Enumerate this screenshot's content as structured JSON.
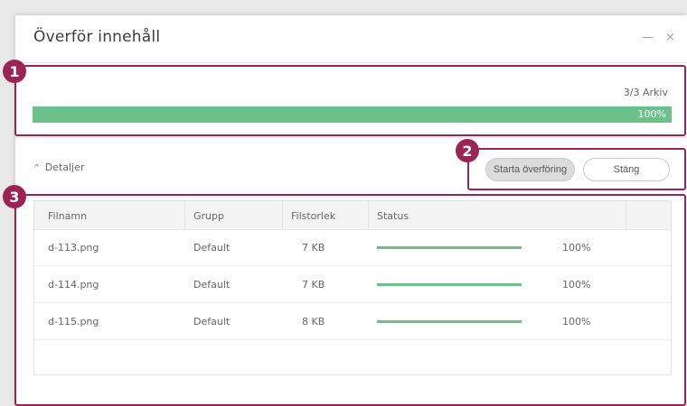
{
  "window": {
    "title": "Överför innehåll",
    "minimize_glyph": "—",
    "close_glyph": "×"
  },
  "overall": {
    "count_text": "3/3 Arkiv",
    "percent_text": "100%",
    "progress": 1.0
  },
  "details": {
    "label": "Detaljer",
    "chevron_glyph": "^"
  },
  "buttons": {
    "start": "Starta överföring",
    "close": "Stäng"
  },
  "table": {
    "columns": [
      "Filnamn",
      "Grupp",
      "Filstorlek",
      "Status"
    ],
    "rows": [
      {
        "name": "d-113.png",
        "group": "Default",
        "size": "7 KB",
        "progress": 1.0,
        "percent": "100%"
      },
      {
        "name": "d-114.png",
        "group": "Default",
        "size": "7 KB",
        "progress": 1.0,
        "percent": "100%"
      },
      {
        "name": "d-115.png",
        "group": "Default",
        "size": "8 KB",
        "progress": 1.0,
        "percent": "100%"
      }
    ]
  },
  "callouts": {
    "c1": "1",
    "c2": "2",
    "c3": "3"
  },
  "colors": {
    "accent_green": "#6cc08a",
    "callout": "#9b2454"
  }
}
